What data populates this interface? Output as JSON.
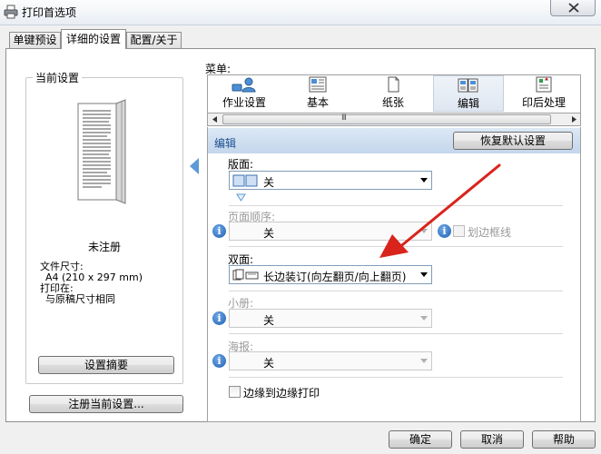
{
  "window": {
    "title": "打印首选项"
  },
  "tabs": [
    {
      "label": "单键预设"
    },
    {
      "label": "详细的设置"
    },
    {
      "label": "配置/关于"
    }
  ],
  "left_panel": {
    "group_title": "当前设置",
    "status": "未注册",
    "paper_size_label": "文件尺寸:",
    "paper_size_value": "A4 (210 x 297 mm)",
    "print_on_label": "打印在:",
    "print_on_value": "与原稿尺寸相同",
    "summary_button": "设置摘要",
    "register_button": "注册当前设置..."
  },
  "menu": {
    "label": "菜单:",
    "items": [
      {
        "label": "作业设置",
        "icon": "job-settings-icon"
      },
      {
        "label": "基本",
        "icon": "basic-icon"
      },
      {
        "label": "纸张",
        "icon": "paper-icon"
      },
      {
        "label": "编辑",
        "icon": "edit-icon"
      },
      {
        "label": "印后处理",
        "icon": "finishing-icon"
      }
    ],
    "active": "编辑",
    "scroll_grip": "III"
  },
  "edit_panel": {
    "title": "编辑",
    "restore_button": "恢复默认设置",
    "layout": {
      "label": "版面:",
      "value": "关"
    },
    "page_order": {
      "label": "页面顺序:",
      "value": "关"
    },
    "border_lines": {
      "label": "划边框线",
      "checked": false
    },
    "duplex": {
      "label": "双面:",
      "value": "长边装订(向左翻页/向上翻页)"
    },
    "booklet": {
      "label": "小册:",
      "value": "关"
    },
    "poster": {
      "label": "海报:",
      "value": "关"
    },
    "edge_to_edge": {
      "label": "边缘到边缘打印",
      "checked": false
    }
  },
  "footer": {
    "ok": "确定",
    "cancel": "取消",
    "help": "帮助"
  },
  "colors": {
    "header_blue": "#c3d6ec",
    "accent_blue": "#5d9ad6",
    "annotation_red": "#d9241c"
  }
}
